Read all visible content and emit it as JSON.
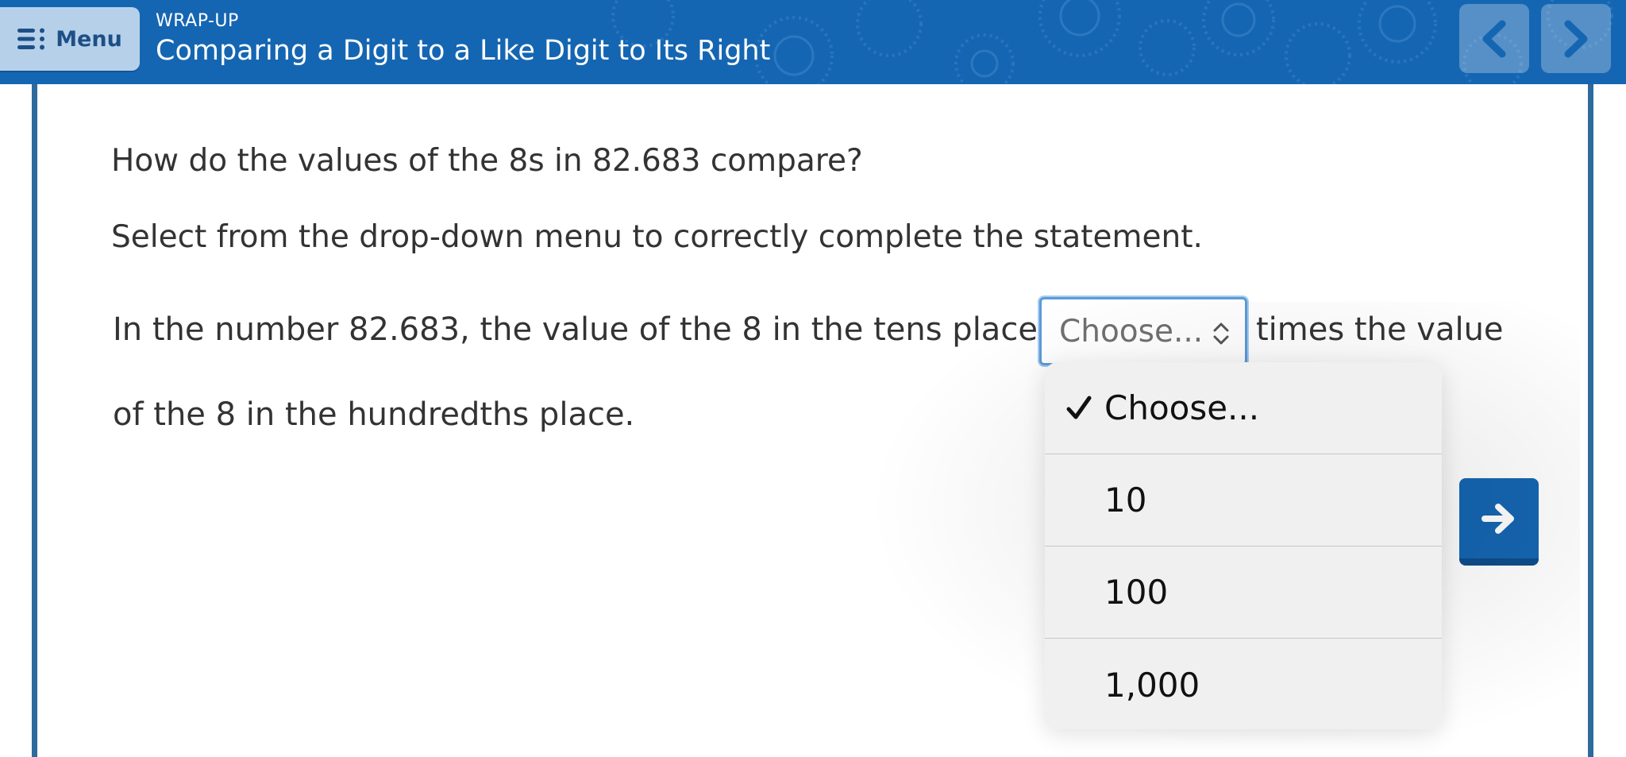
{
  "header": {
    "menu_label": "Menu",
    "menu_icon": "list-menu-icon",
    "section": "WRAP-UP",
    "title": "Comparing a Digit to a Like Digit to Its Right",
    "prev_icon": "chevron-left-icon",
    "next_icon": "chevron-right-icon"
  },
  "question": {
    "prompt": "How do the values of the 8s in 82.683 compare?",
    "instruction": "Select from the drop-down menu to correctly complete the statement.",
    "statement_before": "In the number 82.683, the value of the 8 in the tens place is",
    "statement_after": "times the value",
    "statement_end": "of the 8 in the hundredths place."
  },
  "dropdown": {
    "selected_value": "Choose...",
    "options": [
      {
        "label": "Choose...",
        "checked": true
      },
      {
        "label": "10",
        "checked": false
      },
      {
        "label": "100",
        "checked": false
      },
      {
        "label": "1,000",
        "checked": false
      }
    ]
  },
  "action": {
    "submit_icon": "arrow-right-icon"
  },
  "colors": {
    "header_blue": "#1566b2",
    "frame_border": "#2d6a9e",
    "menu_button": "#b7d0ea",
    "select_focus": "#5b9bd8"
  }
}
